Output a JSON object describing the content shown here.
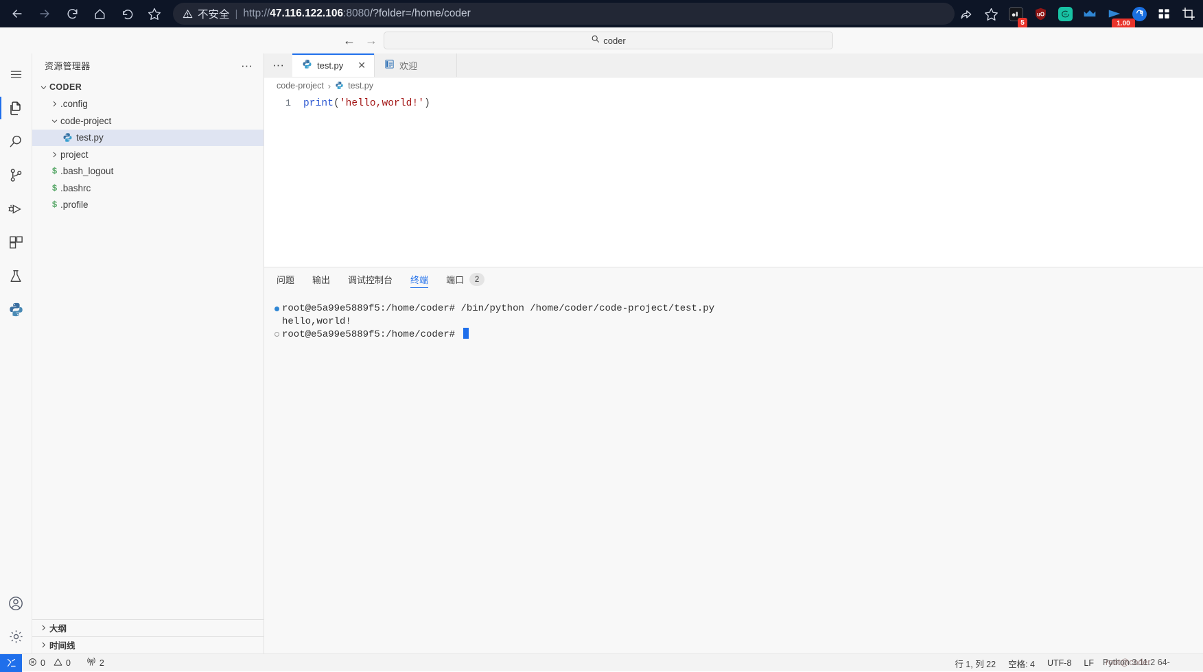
{
  "browser": {
    "nav": {
      "back": "back-arrow",
      "forward": "forward-arrow",
      "reload": "reload",
      "home": "home",
      "undo": "undo",
      "bookmark": "star"
    },
    "omnibox": {
      "security_label": "不安全",
      "separator": "|",
      "scheme": "http://",
      "host": "47.116.122.106",
      "port": ":8080",
      "path": "/?folder=/home/coder",
      "full_url": "http://47.116.122.106:8080/?folder=/home/coder"
    },
    "toolbar_icons": [
      {
        "name": "share-icon",
        "badge": ""
      },
      {
        "name": "favorite-star-icon",
        "badge": ""
      },
      {
        "name": "extension-dark-icon",
        "badge": "5"
      },
      {
        "name": "ublock-shield-icon",
        "badge": ""
      },
      {
        "name": "chat-bubble-icon",
        "badge": ""
      },
      {
        "name": "crown-icon",
        "badge": ""
      },
      {
        "name": "play-triangle-icon",
        "badge": "1.00"
      },
      {
        "name": "browser-blue-icon",
        "badge": ""
      },
      {
        "name": "grid-apps-icon",
        "badge": ""
      },
      {
        "name": "crop-icon",
        "badge": ""
      }
    ]
  },
  "vscode": {
    "command_center": {
      "value": "coder",
      "placeholder": "coder",
      "icon": "search-icon"
    },
    "nav_back": "←",
    "nav_forward": "→",
    "activity_bar": [
      {
        "name": "menu-icon",
        "label": "菜单"
      },
      {
        "name": "explorer-files-icon",
        "label": "资源管理器"
      },
      {
        "name": "search-icon",
        "label": "搜索"
      },
      {
        "name": "source-control-icon",
        "label": "源代码管理"
      },
      {
        "name": "run-debug-icon",
        "label": "运行和调试"
      },
      {
        "name": "extensions-icon",
        "label": "扩展"
      },
      {
        "name": "testing-flask-icon",
        "label": "测试"
      },
      {
        "name": "python-icon",
        "label": "Python"
      },
      {
        "name": "account-icon",
        "label": "帐户"
      },
      {
        "name": "gear-icon",
        "label": "管理"
      }
    ],
    "sidebar": {
      "title": "资源管理器",
      "more_actions": "···",
      "root": "CODER",
      "tree": [
        {
          "label": ".config",
          "type": "folder",
          "expanded": false,
          "depth": 1,
          "selected": false
        },
        {
          "label": "code-project",
          "type": "folder",
          "expanded": true,
          "depth": 1,
          "selected": false
        },
        {
          "label": "test.py",
          "type": "python",
          "expanded": null,
          "depth": 2,
          "selected": true
        },
        {
          "label": "project",
          "type": "folder",
          "expanded": false,
          "depth": 1,
          "selected": false
        },
        {
          "label": ".bash_logout",
          "type": "shell",
          "expanded": null,
          "depth": 1,
          "selected": false
        },
        {
          "label": ".bashrc",
          "type": "shell",
          "expanded": null,
          "depth": 1,
          "selected": false
        },
        {
          "label": ".profile",
          "type": "shell",
          "expanded": null,
          "depth": 1,
          "selected": false
        }
      ],
      "sections": [
        {
          "label": "大纲"
        },
        {
          "label": "时间线"
        }
      ]
    },
    "editor": {
      "more_actions": "···",
      "tabs": [
        {
          "label": "test.py",
          "icon": "python-file-icon",
          "active": true,
          "closable": true,
          "close": "✕"
        },
        {
          "label": "欢迎",
          "icon": "welcome-page-icon",
          "active": false,
          "closable": false,
          "close": ""
        }
      ],
      "breadcrumb": [
        {
          "label": "code-project",
          "icon": ""
        },
        {
          "label": "test.py",
          "icon": "python-file-icon"
        }
      ],
      "breadcrumb_separator": "›",
      "line_number": "1",
      "code": {
        "fn": "print",
        "open_paren": "(",
        "string": "'hello,world!'",
        "close_paren": ")"
      }
    },
    "panel": {
      "tabs": [
        {
          "label": "问题",
          "active": false,
          "badge": ""
        },
        {
          "label": "输出",
          "active": false,
          "badge": ""
        },
        {
          "label": "调试控制台",
          "active": false,
          "badge": ""
        },
        {
          "label": "终端",
          "active": true,
          "badge": ""
        },
        {
          "label": "端口",
          "active": false,
          "badge": "2"
        }
      ],
      "terminal_lines": [
        {
          "marker": "filled",
          "prompt": "root@e5a99e5889f5:/home/coder# ",
          "command": "/bin/python /home/coder/code-project/test.py",
          "cursor": false
        },
        {
          "marker": "none",
          "prompt": "",
          "command": "hello,world!",
          "cursor": false
        },
        {
          "marker": "hollow",
          "prompt": "root@e5a99e5889f5:/home/coder# ",
          "command": "",
          "cursor": true
        }
      ]
    },
    "status_bar": {
      "remote_icon": "remote-window-icon",
      "errors_icon": "error-circle-icon",
      "errors": "0",
      "warnings_icon": "warning-triangle-icon",
      "warnings": "0",
      "ports_icon": "radio-tower-icon",
      "ports": "2",
      "cursor_position": "行 1, 列 22",
      "indentation": "空格: 4",
      "encoding": "UTF-8",
      "eol": "LF",
      "language_overlap_a": "Python 3.11.2 64-",
      "language_overlap_b": "root@coder"
    }
  },
  "colors": {
    "chrome_bg": "#0d1526",
    "accent_blue": "#1f6feb",
    "selection": "#dfe4f2",
    "badge_red": "#e8332a",
    "shell_green": "#59a869",
    "string_red": "#a31515",
    "keyword_blue": "#2b57d1"
  }
}
